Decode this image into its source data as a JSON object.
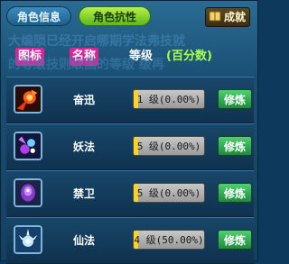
{
  "tabs": [
    {
      "label": "角色信息",
      "active": false
    },
    {
      "label": "角色抗性",
      "active": true
    }
  ],
  "achievement_label": "成就",
  "background_text": {
    "line1": "大编陨已经开启哪期学法弗技就",
    "line2": "的等级技则取国的等级 级再"
  },
  "header": {
    "icon": "图标",
    "name": "名称",
    "level": "等级",
    "percent": "(百分数)"
  },
  "skills": [
    {
      "name": "奋迅",
      "level_text": "1 级(0.00%)",
      "progress_percent": 0,
      "train_label": "修炼",
      "icon": "fire-burst-icon"
    },
    {
      "name": "妖法",
      "level_text": "5 级(0.00%)",
      "progress_percent": 0,
      "train_label": "修炼",
      "icon": "purple-magic-icon"
    },
    {
      "name": "禁卫",
      "level_text": "5 级(0.00%)",
      "progress_percent": 0,
      "train_label": "修炼",
      "icon": "violet-orb-icon"
    },
    {
      "name": "仙法",
      "level_text": "4 级(50.00%)",
      "progress_percent": 50,
      "train_label": "修炼",
      "icon": "white-spark-icon"
    }
  ],
  "colors": {
    "active_tab": "#5cb81c",
    "header_pink": "#d8259a",
    "header_green": "#a8ff4a",
    "train_button": "#1e8a3c",
    "level_marker": "#ffd21e"
  }
}
